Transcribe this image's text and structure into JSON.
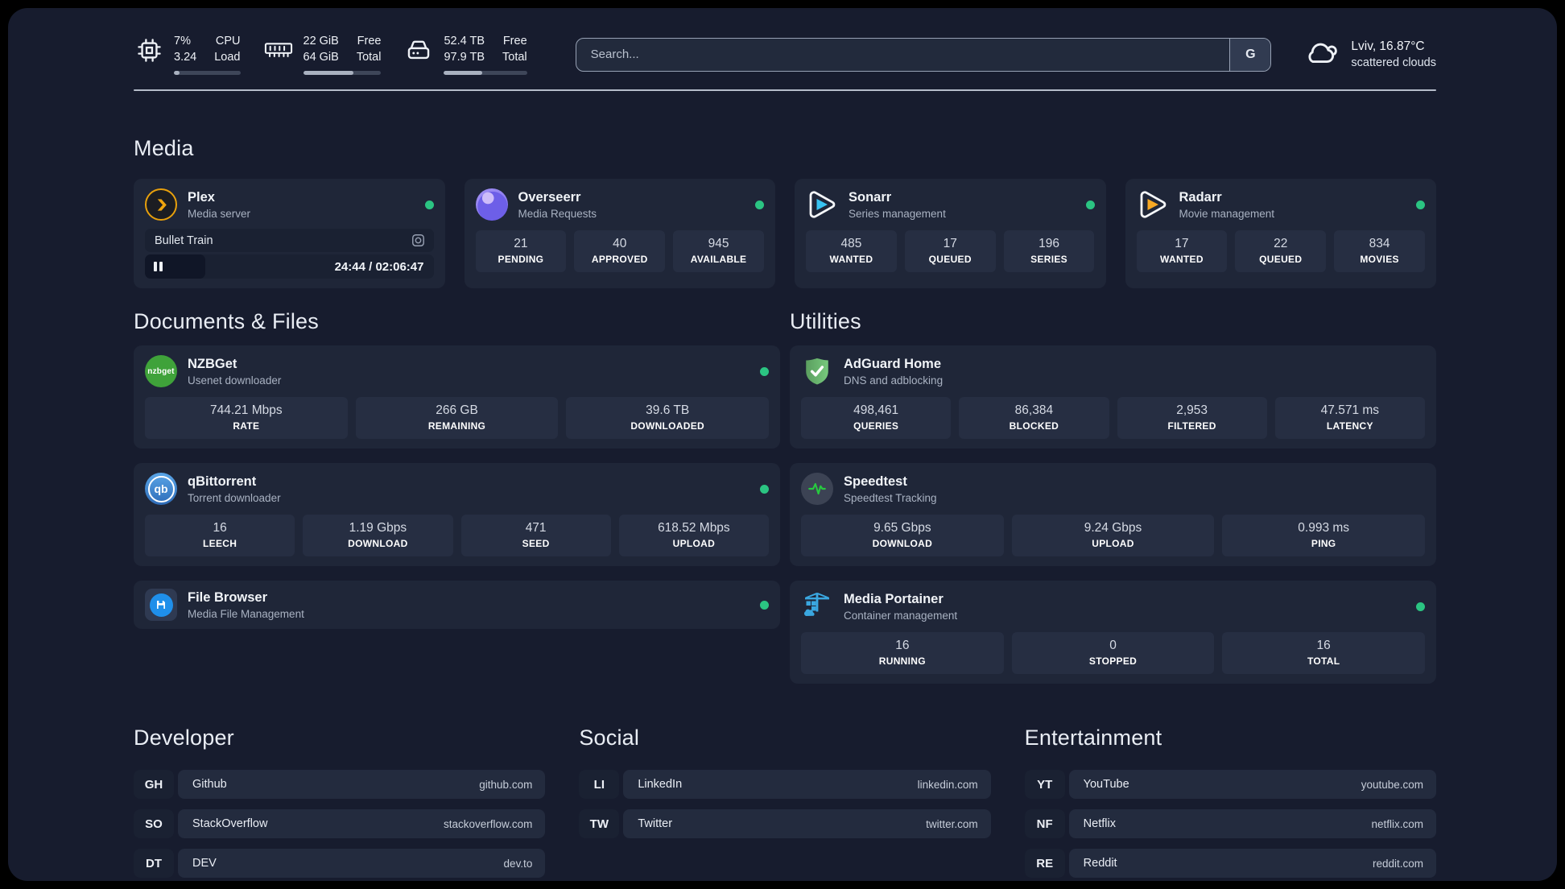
{
  "topbar": {
    "stats": [
      {
        "icon": "cpu-icon",
        "value1": "7%",
        "value2": "3.24",
        "label1": "CPU",
        "label2": "Load",
        "progress": 8
      },
      {
        "icon": "ram-icon",
        "value1": "22 GiB",
        "value2": "64 GiB",
        "label1": "Free",
        "label2": "Total",
        "progress": 64
      },
      {
        "icon": "disk-icon",
        "value1": "52.4 TB",
        "value2": "97.9 TB",
        "label1": "Free",
        "label2": "Total",
        "progress": 46
      }
    ],
    "search": {
      "placeholder": "Search...",
      "button": "G"
    },
    "weather": {
      "location": "Lviv, 16.87°C",
      "condition": "scattered clouds"
    }
  },
  "media": {
    "title": "Media",
    "cards": [
      {
        "name": "Plex",
        "desc": "Media server",
        "online": true,
        "player": {
          "title": "Bullet Train",
          "time": "24:44 / 02:06:47",
          "progress": 21
        }
      },
      {
        "name": "Overseerr",
        "desc": "Media Requests",
        "online": true,
        "stats": [
          {
            "value": "21",
            "label": "PENDING"
          },
          {
            "value": "40",
            "label": "APPROVED"
          },
          {
            "value": "945",
            "label": "AVAILABLE"
          }
        ]
      },
      {
        "name": "Sonarr",
        "desc": "Series management",
        "online": true,
        "stats": [
          {
            "value": "485",
            "label": "WANTED"
          },
          {
            "value": "17",
            "label": "QUEUED"
          },
          {
            "value": "196",
            "label": "SERIES"
          }
        ]
      },
      {
        "name": "Radarr",
        "desc": "Movie management",
        "online": true,
        "stats": [
          {
            "value": "17",
            "label": "WANTED"
          },
          {
            "value": "22",
            "label": "QUEUED"
          },
          {
            "value": "834",
            "label": "MOVIES"
          }
        ]
      }
    ]
  },
  "documents": {
    "title": "Documents & Files",
    "cards": [
      {
        "name": "NZBGet",
        "desc": "Usenet downloader",
        "online": true,
        "stats": [
          {
            "value": "744.21 Mbps",
            "label": "RATE"
          },
          {
            "value": "266 GB",
            "label": "REMAINING"
          },
          {
            "value": "39.6 TB",
            "label": "DOWNLOADED"
          }
        ]
      },
      {
        "name": "qBittorrent",
        "desc": "Torrent downloader",
        "online": true,
        "stats": [
          {
            "value": "16",
            "label": "LEECH"
          },
          {
            "value": "1.19 Gbps",
            "label": "DOWNLOAD"
          },
          {
            "value": "471",
            "label": "SEED"
          },
          {
            "value": "618.52 Mbps",
            "label": "UPLOAD"
          }
        ]
      },
      {
        "name": "File Browser",
        "desc": "Media File Management",
        "online": true
      }
    ]
  },
  "utilities": {
    "title": "Utilities",
    "cards": [
      {
        "name": "AdGuard Home",
        "desc": "DNS and adblocking",
        "stats": [
          {
            "value": "498,461",
            "label": "QUERIES"
          },
          {
            "value": "86,384",
            "label": "BLOCKED"
          },
          {
            "value": "2,953",
            "label": "FILTERED"
          },
          {
            "value": "47.571 ms",
            "label": "LATENCY"
          }
        ]
      },
      {
        "name": "Speedtest",
        "desc": "Speedtest Tracking",
        "stats": [
          {
            "value": "9.65 Gbps",
            "label": "DOWNLOAD"
          },
          {
            "value": "9.24 Gbps",
            "label": "UPLOAD"
          },
          {
            "value": "0.993 ms",
            "label": "PING"
          }
        ]
      },
      {
        "name": "Media Portainer",
        "desc": "Container management",
        "online": true,
        "stats": [
          {
            "value": "16",
            "label": "RUNNING"
          },
          {
            "value": "0",
            "label": "STOPPED"
          },
          {
            "value": "16",
            "label": "TOTAL"
          }
        ]
      }
    ]
  },
  "links": {
    "developer": {
      "title": "Developer",
      "items": [
        {
          "abbr": "GH",
          "name": "Github",
          "url": "github.com"
        },
        {
          "abbr": "SO",
          "name": "StackOverflow",
          "url": "stackoverflow.com"
        },
        {
          "abbr": "DT",
          "name": "DEV",
          "url": "dev.to"
        }
      ]
    },
    "social": {
      "title": "Social",
      "items": [
        {
          "abbr": "LI",
          "name": "LinkedIn",
          "url": "linkedin.com"
        },
        {
          "abbr": "TW",
          "name": "Twitter",
          "url": "twitter.com"
        }
      ]
    },
    "entertainment": {
      "title": "Entertainment",
      "items": [
        {
          "abbr": "YT",
          "name": "YouTube",
          "url": "youtube.com"
        },
        {
          "abbr": "NF",
          "name": "Netflix",
          "url": "netflix.com"
        },
        {
          "abbr": "RE",
          "name": "Reddit",
          "url": "reddit.com"
        }
      ]
    }
  },
  "icons": {
    "qbittorrent_text": "qb",
    "nzbget_text": "nzbget"
  },
  "colors": {
    "status_online": "#2bc482",
    "plex": "#e8a00c",
    "overseerr": "#8a7cf0",
    "sonarr": "#38c3f1",
    "radarr": "#f7a823",
    "nzbget": "#3fa23a",
    "qbittorrent": "#3a77c2",
    "filebrowser": "#1f8fea",
    "adguard": "#68bc71",
    "speedtest_pulse": "#27c93f",
    "portainer": "#3aa7e0",
    "background": "#171c2e",
    "card": "#1f2638",
    "tile": "#262e42"
  }
}
